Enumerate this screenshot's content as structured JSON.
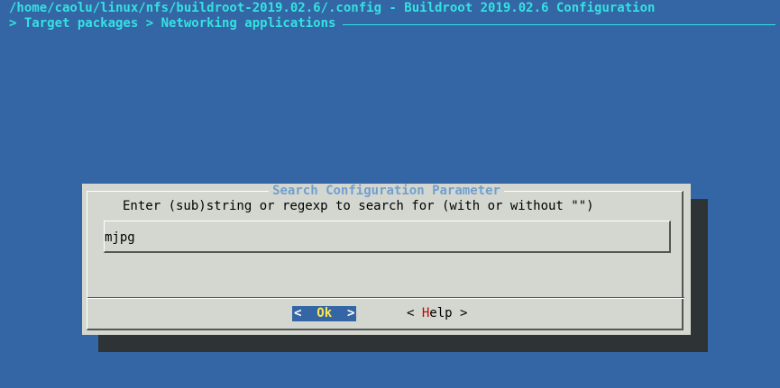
{
  "header": {
    "title": "/home/caolu/linux/nfs/buildroot-2019.02.6/.config - Buildroot 2019.02.6 Configuration",
    "breadcrumb": "> Target packages > Networking applications"
  },
  "dialog": {
    "title": "Search Configuration Parameter",
    "prompt": "Enter (sub)string or regexp to search for (with or without \"\")",
    "input_value": "mjpg",
    "buttons": {
      "ok": {
        "left": "<  ",
        "hotkey": "Ok",
        "right": "  >"
      },
      "help": {
        "left": "< ",
        "hotkey": "H",
        "rest": "elp",
        "right": " >"
      }
    }
  },
  "colors": {
    "background": "#3465a4",
    "header_text": "#34e2e2",
    "dialog_bg": "#d3d7cf",
    "dialog_title": "#729fcf",
    "ok_hotkey": "#fce94f",
    "help_hotkey": "#cc0000"
  }
}
